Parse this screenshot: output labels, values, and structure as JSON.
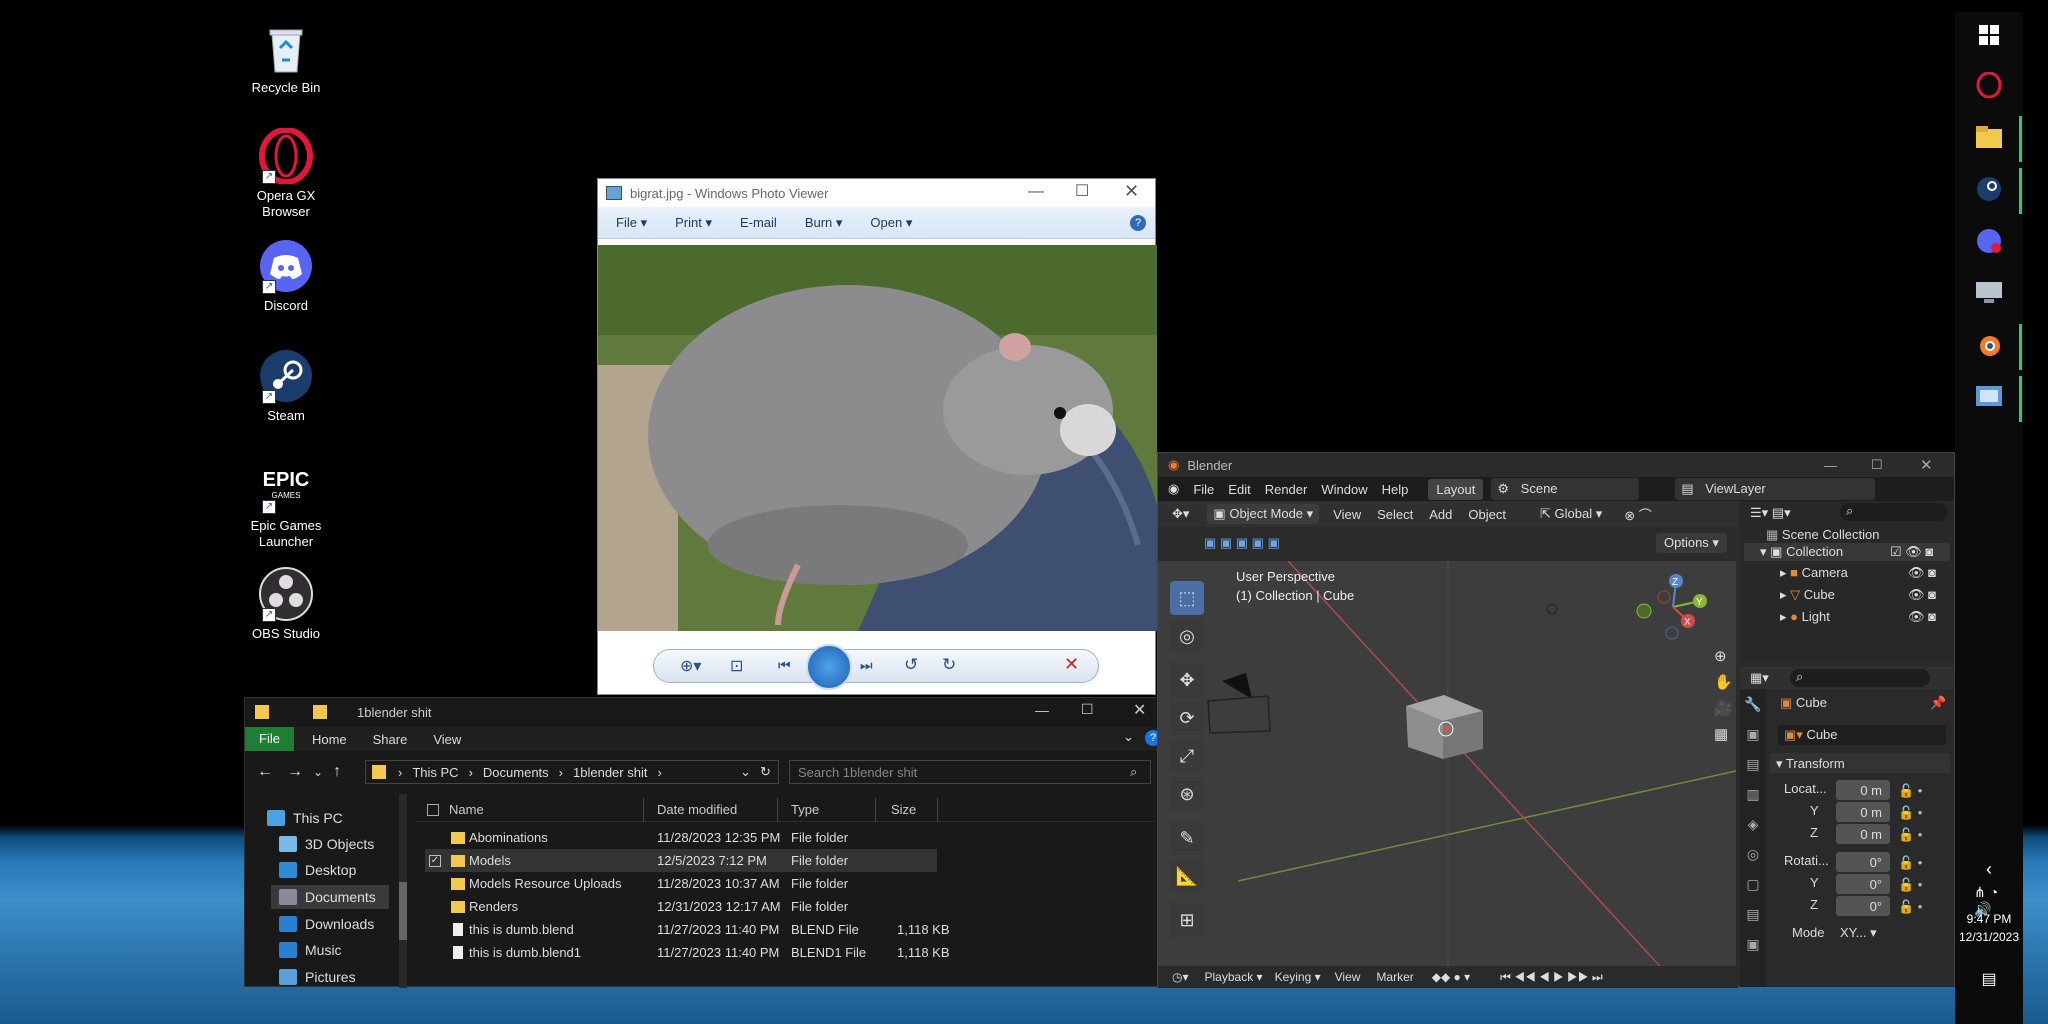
{
  "desktop": {
    "icons": [
      {
        "label": "Recycle Bin"
      },
      {
        "label": "Opera GX Browser"
      },
      {
        "label": "Discord"
      },
      {
        "label": "Steam"
      },
      {
        "label": "Epic Games Launcher"
      },
      {
        "label": "OBS Studio"
      }
    ]
  },
  "photo_viewer": {
    "title": "bigrat.jpg - Windows Photo Viewer",
    "menu": [
      "File",
      "Print",
      "E-mail",
      "Burn",
      "Open"
    ]
  },
  "explorer": {
    "title": "1blender shit",
    "ribbon_tabs": [
      "File",
      "Home",
      "Share",
      "View"
    ],
    "breadcrumb": [
      "This PC",
      "Documents",
      "1blender shit"
    ],
    "search_placeholder": "Search 1blender shit",
    "nav": [
      "This PC",
      "3D Objects",
      "Desktop",
      "Documents",
      "Downloads",
      "Music",
      "Pictures"
    ],
    "columns": [
      "Name",
      "Date modified",
      "Type",
      "Size"
    ],
    "files": [
      {
        "name": "Abominations",
        "date": "11/28/2023 12:35 PM",
        "type": "File folder",
        "size": ""
      },
      {
        "name": "Models",
        "date": "12/5/2023 7:12 PM",
        "type": "File folder",
        "size": ""
      },
      {
        "name": "Models Resource Uploads",
        "date": "11/28/2023 10:37 AM",
        "type": "File folder",
        "size": ""
      },
      {
        "name": "Renders",
        "date": "12/31/2023 12:17 AM",
        "type": "File folder",
        "size": ""
      },
      {
        "name": "this is dumb.blend",
        "date": "11/27/2023 11:40 PM",
        "type": "BLEND File",
        "size": "1,118 KB"
      },
      {
        "name": "this is dumb.blend1",
        "date": "11/27/2023 11:40 PM",
        "type": "BLEND1 File",
        "size": "1,118 KB"
      }
    ]
  },
  "blender": {
    "title": "Blender",
    "menu": [
      "File",
      "Edit",
      "Render",
      "Window",
      "Help"
    ],
    "workspace": "Layout",
    "scene": "Scene",
    "view_layer": "ViewLayer",
    "mode": "Object Mode",
    "header_menu": [
      "View",
      "Select",
      "Add",
      "Object"
    ],
    "orientation": "Global",
    "options": "Options",
    "viewport_title": "User Perspective",
    "viewport_sub": "(1) Collection | Cube",
    "outliner": {
      "root": "Scene Collection",
      "collection": "Collection",
      "items": [
        "Camera",
        "Cube",
        "Light"
      ]
    },
    "properties": {
      "object": "Cube",
      "object_field": "Cube",
      "panel": "Transform",
      "location_label": "Locat...",
      "rotation_label": "Rotati...",
      "mode_label": "Mode",
      "mode_value": "XY...",
      "axes": [
        "Y",
        "Z"
      ],
      "loc": [
        "0 m",
        "0 m",
        "0 m"
      ],
      "rot": [
        "0°",
        "0°",
        "0°"
      ]
    },
    "timeline": [
      "Playback",
      "Keying",
      "View",
      "Marker"
    ]
  },
  "taskbar": {
    "time": "9:47 PM",
    "date": "12/31/2023"
  }
}
